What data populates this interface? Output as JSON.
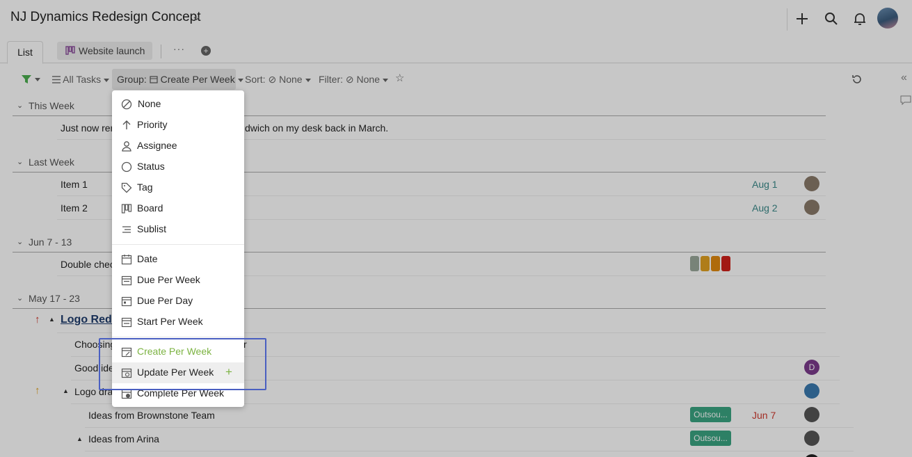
{
  "app": {
    "title": "NJ Dynamics Redesign Concept",
    "tabs": {
      "list": "List",
      "website": "Website launch",
      "more": "···",
      "add": "+"
    }
  },
  "toolbar": {
    "all_tasks": "All Tasks",
    "group_label": "Group:",
    "group_value": "Create Per Week",
    "sort_label": "Sort:",
    "sort_value": "None",
    "filter_label": "Filter:",
    "filter_value": "None"
  },
  "sections": {
    "this_week": "This Week",
    "last_week": "Last Week",
    "jun": "Jun 7 - 13",
    "may": "May 17 - 23"
  },
  "rows": {
    "r1": "Just now rer",
    "r1b": "dwich on my desk back in March.",
    "item1": "Item 1",
    "item1_date": "Aug 1",
    "item2": "Item 2",
    "item2_date": "Aug 2",
    "double": "Double chec",
    "logo": "Logo Redes",
    "choosing": "Choosing",
    "choosing_end": "r",
    "good": "Good ide",
    "logo_dra": "Logo dra",
    "brownstone": "Ideas from Brownstone Team",
    "brownstone_tag": "Outsou...",
    "brownstone_date": "Jun 7",
    "arina": "Ideas from Arina",
    "arina_tag": "Outsou...",
    "avatar_d": "D"
  },
  "dropdown": {
    "none": "None",
    "priority": "Priority",
    "assignee": "Assignee",
    "status": "Status",
    "tag": "Tag",
    "board": "Board",
    "sublist": "Sublist",
    "date": "Date",
    "due_week": "Due Per Week",
    "due_day": "Due Per Day",
    "start_week": "Start Per Week",
    "create_week": "Create Per Week",
    "update_week": "Update Per Week",
    "complete_week": "Complete Per Week"
  },
  "colors": {
    "accent": "#7cb342",
    "date_teal": "#3a8a8a",
    "date_red": "#d0392e",
    "tag_green": "#3aa482",
    "highlight": "#4a5fc1"
  }
}
